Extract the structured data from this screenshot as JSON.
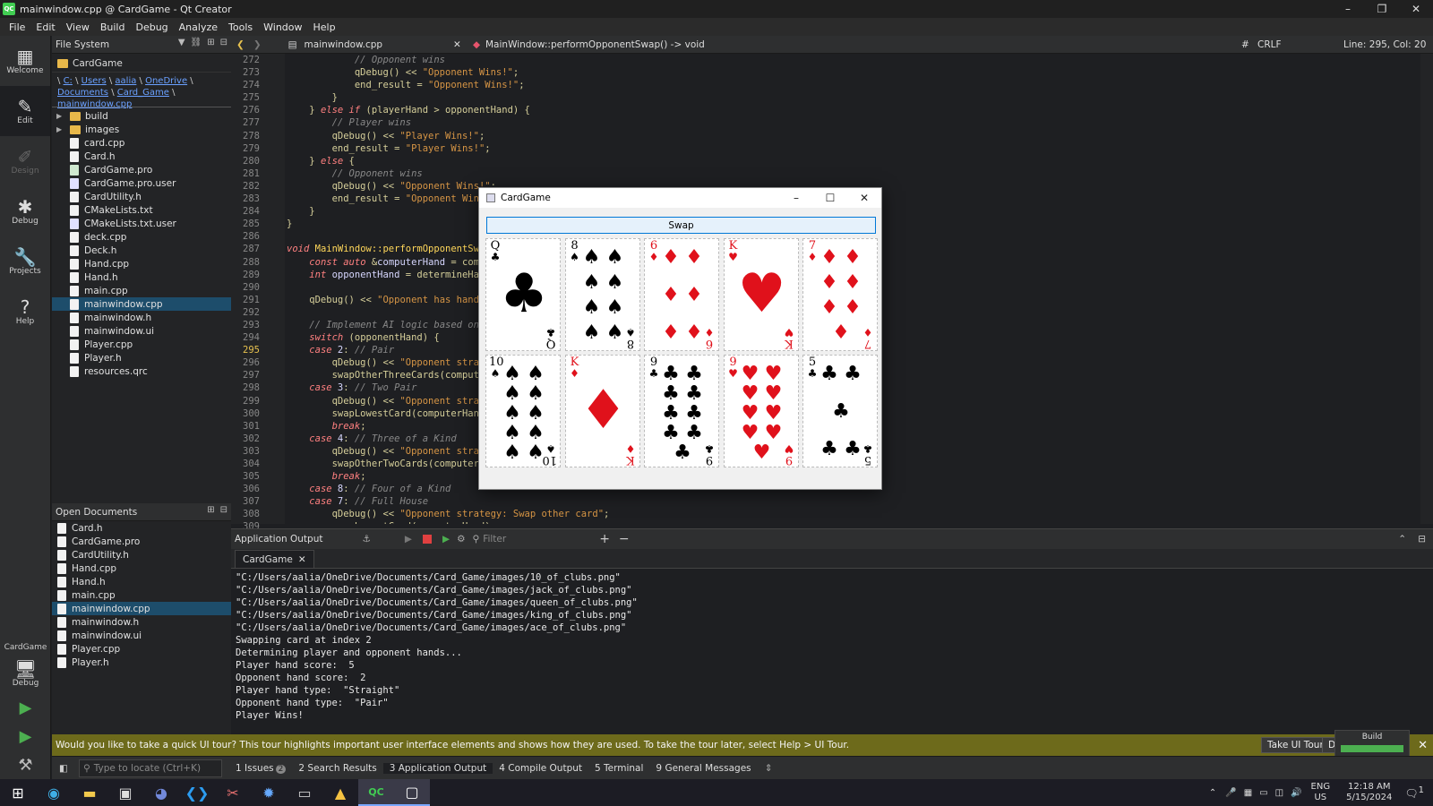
{
  "window": {
    "title": "mainwindow.cpp @ CardGame - Qt Creator",
    "logo": "QC"
  },
  "menu": [
    "File",
    "Edit",
    "View",
    "Build",
    "Debug",
    "Analyze",
    "Tools",
    "Window",
    "Help"
  ],
  "modes": [
    {
      "label": "Welcome",
      "icon": "▦"
    },
    {
      "label": "Edit",
      "icon": "✎"
    },
    {
      "label": "Design",
      "icon": "✐"
    },
    {
      "label": "Debug",
      "icon": "✱"
    },
    {
      "label": "Projects",
      "icon": "🔧"
    },
    {
      "label": "Help",
      "icon": "?"
    }
  ],
  "kit": {
    "project": "CardGame",
    "mode": "Debug"
  },
  "sidebar": {
    "title": "File System",
    "combo": "CardGame",
    "crumb_prefix": "\\ ",
    "crumbs": [
      "C:",
      "Users",
      "aalia",
      "OneDrive",
      "Documents",
      "Card_Game",
      "mainwindow.cpp"
    ],
    "tree": [
      {
        "name": "build",
        "type": "folder"
      },
      {
        "name": "images",
        "type": "folder"
      },
      {
        "name": "card.cpp",
        "type": "file"
      },
      {
        "name": "Card.h",
        "type": "file"
      },
      {
        "name": "CardGame.pro",
        "type": "pro"
      },
      {
        "name": "CardGame.pro.user",
        "type": "ui"
      },
      {
        "name": "CardUtility.h",
        "type": "file"
      },
      {
        "name": "CMakeLists.txt",
        "type": "file"
      },
      {
        "name": "CMakeLists.txt.user",
        "type": "ui"
      },
      {
        "name": "deck.cpp",
        "type": "file"
      },
      {
        "name": "Deck.h",
        "type": "file"
      },
      {
        "name": "Hand.cpp",
        "type": "file"
      },
      {
        "name": "Hand.h",
        "type": "file"
      },
      {
        "name": "main.cpp",
        "type": "file"
      },
      {
        "name": "mainwindow.cpp",
        "type": "file",
        "selected": true
      },
      {
        "name": "mainwindow.h",
        "type": "file"
      },
      {
        "name": "mainwindow.ui",
        "type": "file"
      },
      {
        "name": "Player.cpp",
        "type": "file"
      },
      {
        "name": "Player.h",
        "type": "file"
      },
      {
        "name": "resources.qrc",
        "type": "file"
      }
    ]
  },
  "open_documents": {
    "title": "Open Documents",
    "items": [
      "Card.h",
      "CardGame.pro",
      "CardUtility.h",
      "Hand.cpp",
      "Hand.h",
      "main.cpp",
      "mainwindow.cpp",
      "mainwindow.h",
      "mainwindow.ui",
      "Player.cpp",
      "Player.h"
    ],
    "selected": "mainwindow.cpp"
  },
  "editor": {
    "file_tab": "mainwindow.cpp",
    "function": "MainWindow::performOpponentSwap() -> void",
    "line_ending": "CRLF",
    "position": "Line: 295, Col: 20",
    "current_line": 295,
    "lines": [
      {
        "n": 272,
        "html": "            <span class='cm'>// Opponent wins</span>"
      },
      {
        "n": 273,
        "html": "            qDebug() &lt;&lt; <span class='st'>\"Opponent Wins!\"</span>;"
      },
      {
        "n": 274,
        "html": "            end_result = <span class='st'>\"Opponent Wins!\"</span>;"
      },
      {
        "n": 275,
        "html": "        }"
      },
      {
        "n": 276,
        "html": "    } <span class='kw'>else if</span> (playerHand &gt; opponentHand) {"
      },
      {
        "n": 277,
        "html": "        <span class='cm'>// Player wins</span>"
      },
      {
        "n": 278,
        "html": "        qDebug() &lt;&lt; <span class='st'>\"Player Wins!\"</span>;"
      },
      {
        "n": 279,
        "html": "        end_result = <span class='st'>\"Player Wins!\"</span>;"
      },
      {
        "n": 280,
        "html": "    } <span class='kw'>else</span> {"
      },
      {
        "n": 281,
        "html": "        <span class='cm'>// Opponent wins</span>"
      },
      {
        "n": 282,
        "html": "        qDebug() &lt;&lt; <span class='st'>\"Opponent Wins!\"</span>;"
      },
      {
        "n": 283,
        "html": "        end_result = <span class='st'>\"Opponent Wins!\"</span>;"
      },
      {
        "n": 284,
        "html": "    }"
      },
      {
        "n": 285,
        "html": "}"
      },
      {
        "n": 286,
        "html": ""
      },
      {
        "n": 287,
        "html": "<span class='kw'>void</span> <span class='fn'>MainWindow::performOpponentSwap</span>() {"
      },
      {
        "n": 288,
        "html": "    <span class='kw'>const auto</span> &amp;<span class='nm'>computerHand</span> = computer.getHand();"
      },
      {
        "n": 289,
        "html": "    <span class='kw'>int</span> <span class='nm'>opponentHand</span> = determineHand(computerHand);"
      },
      {
        "n": 290,
        "html": ""
      },
      {
        "n": 291,
        "html": "    qDebug() &lt;&lt; <span class='st'>\"Opponent has hand type: \"</span> &lt;&lt; opponentHand;"
      },
      {
        "n": 292,
        "html": ""
      },
      {
        "n": 293,
        "html": "    <span class='cm'>// Implement AI logic based on hand type</span>"
      },
      {
        "n": 294,
        "html": "    <span class='kw'>switch</span> (opponentHand) {"
      },
      {
        "n": 295,
        "html": "    <span class='kw'>case</span> <span class='nm'>2</span>: <span class='cm'>// Pair</span>"
      },
      {
        "n": 296,
        "html": "        qDebug() &lt;&lt; <span class='st'>\"Opponent strategy: Swap other three\"</span>;"
      },
      {
        "n": 297,
        "html": "        swapOtherThreeCards(computerHand);"
      },
      {
        "n": 298,
        "html": "    <span class='kw'>case</span> <span class='nm'>3</span>: <span class='cm'>// Two Pair</span>"
      },
      {
        "n": 299,
        "html": "        qDebug() &lt;&lt; <span class='st'>\"Opponent strategy: Swap lowest card\"</span>;"
      },
      {
        "n": 300,
        "html": "        swapLowestCard(computerHand);"
      },
      {
        "n": 301,
        "html": "        <span class='kw'>break</span>;"
      },
      {
        "n": 302,
        "html": "    <span class='kw'>case</span> <span class='nm'>4</span>: <span class='cm'>// Three of a Kind</span>"
      },
      {
        "n": 303,
        "html": "        qDebug() &lt;&lt; <span class='st'>\"Opponent strategy: Swap other two\"</span>;"
      },
      {
        "n": 304,
        "html": "        swapOtherTwoCards(computerHand);"
      },
      {
        "n": 305,
        "html": "        <span class='kw'>break</span>;"
      },
      {
        "n": 306,
        "html": "    <span class='kw'>case</span> <span class='nm'>8</span>: <span class='cm'>// Four of a Kind</span>"
      },
      {
        "n": 307,
        "html": "    <span class='kw'>case</span> <span class='nm'>7</span>: <span class='cm'>// Full House</span>"
      },
      {
        "n": 308,
        "html": "        qDebug() &lt;&lt; <span class='st'>\"Opponent strategy: Swap other card\"</span>;"
      },
      {
        "n": 309,
        "html": "        swapLowestCard(computerHand);"
      }
    ]
  },
  "output": {
    "title": "Application Output",
    "filter_placeholder": "Filter",
    "tab": "CardGame",
    "lines": [
      "\"C:/Users/aalia/OneDrive/Documents/Card_Game/images/10_of_clubs.png\"",
      "\"C:/Users/aalia/OneDrive/Documents/Card_Game/images/jack_of_clubs.png\"",
      "\"C:/Users/aalia/OneDrive/Documents/Card_Game/images/queen_of_clubs.png\"",
      "\"C:/Users/aalia/OneDrive/Documents/Card_Game/images/king_of_clubs.png\"",
      "\"C:/Users/aalia/OneDrive/Documents/Card_Game/images/ace_of_clubs.png\"",
      "Swapping card at index 2",
      "Determining player and opponent hands...",
      "Player hand score:  5",
      "Opponent hand score:  2",
      "Player hand type:  \"Straight\"",
      "Opponent hand type:  \"Pair\"",
      "Player Wins!"
    ]
  },
  "infobar": {
    "text": "Would you like to take a quick UI tour? This tour highlights important user interface elements and shows how they are used. To take the tour later, select Help > UI Tour.",
    "tour_button": "Take UI Tour",
    "dismiss_button": "Do",
    "build_label": "Build",
    "build_progress": 1.0
  },
  "statusbar": {
    "locator_placeholder": "Type to locate (Ctrl+K)",
    "tabs": [
      {
        "label": "1  Issues",
        "badge": "2"
      },
      {
        "label": "2  Search Results"
      },
      {
        "label": "3  Application Output",
        "active": true
      },
      {
        "label": "4  Compile Output"
      },
      {
        "label": "5  Terminal"
      },
      {
        "label": "9  General Messages"
      }
    ]
  },
  "dialog": {
    "title": "CardGame",
    "swap_label": "Swap",
    "cards": [
      {
        "rank": "Q",
        "suit": "♣",
        "color": "black",
        "pips": 0
      },
      {
        "rank": "8",
        "suit": "♠",
        "color": "black",
        "pips": 8
      },
      {
        "rank": "6",
        "suit": "♦",
        "color": "red",
        "pips": 6
      },
      {
        "rank": "K",
        "suit": "♥",
        "color": "red",
        "pips": 0
      },
      {
        "rank": "7",
        "suit": "♦",
        "color": "red",
        "pips": 7
      },
      {
        "rank": "10",
        "suit": "♠",
        "color": "black",
        "pips": 10
      },
      {
        "rank": "K",
        "suit": "♦",
        "color": "red",
        "pips": 0
      },
      {
        "rank": "9",
        "suit": "♣",
        "color": "black",
        "pips": 9
      },
      {
        "rank": "9",
        "suit": "♥",
        "color": "red",
        "pips": 9
      },
      {
        "rank": "5",
        "suit": "♣",
        "color": "black",
        "pips": 5
      }
    ]
  },
  "taskbar": {
    "lang": "ENG",
    "region": "US",
    "time": "12:18 AM",
    "date": "5/15/2024",
    "notifications": "1"
  }
}
